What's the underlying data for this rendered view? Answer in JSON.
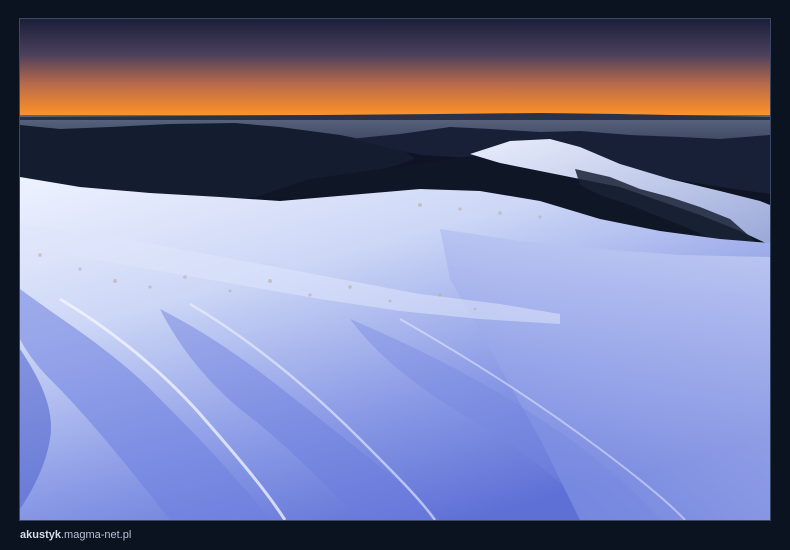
{
  "photo": {
    "subject": "snow-covered mountain ridge at dusk",
    "colors": {
      "sky_top": "#1b1f38",
      "sky_horizon": "#f08a2c",
      "snow": "#e3eafc",
      "snow_shadow": "#5f74d8",
      "ridges": "#121a2c",
      "frame_bg": "#0b1220"
    }
  },
  "credit": {
    "author": "akustyk",
    "site": ".magma-net.pl"
  }
}
